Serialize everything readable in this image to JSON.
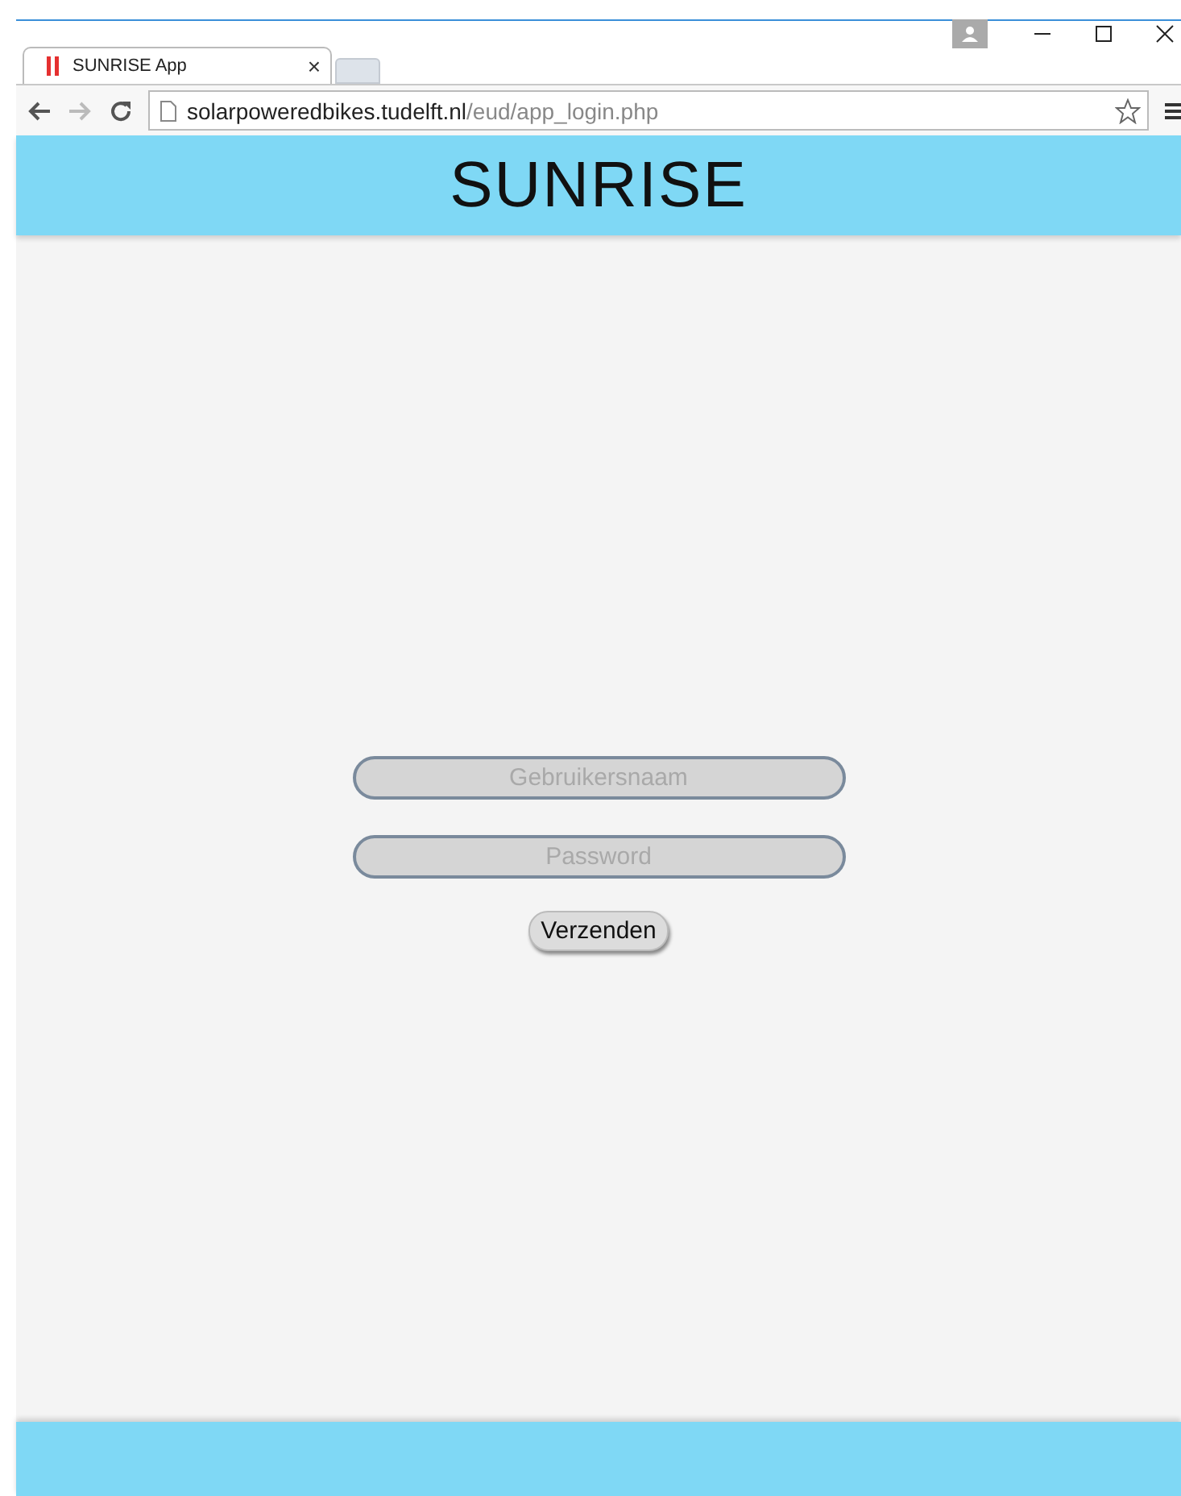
{
  "browser": {
    "tab": {
      "title": "SUNRISE App",
      "close": "×"
    },
    "address": {
      "host": "solarpoweredbikes.tudelft.nl",
      "path": "/eud/app_login.php"
    }
  },
  "header": {
    "title": "SUNRISE"
  },
  "login": {
    "fields": [
      {
        "placeholder": "Gebruikersnaam"
      },
      {
        "placeholder": "Password"
      }
    ],
    "submit": "Verzenden"
  }
}
